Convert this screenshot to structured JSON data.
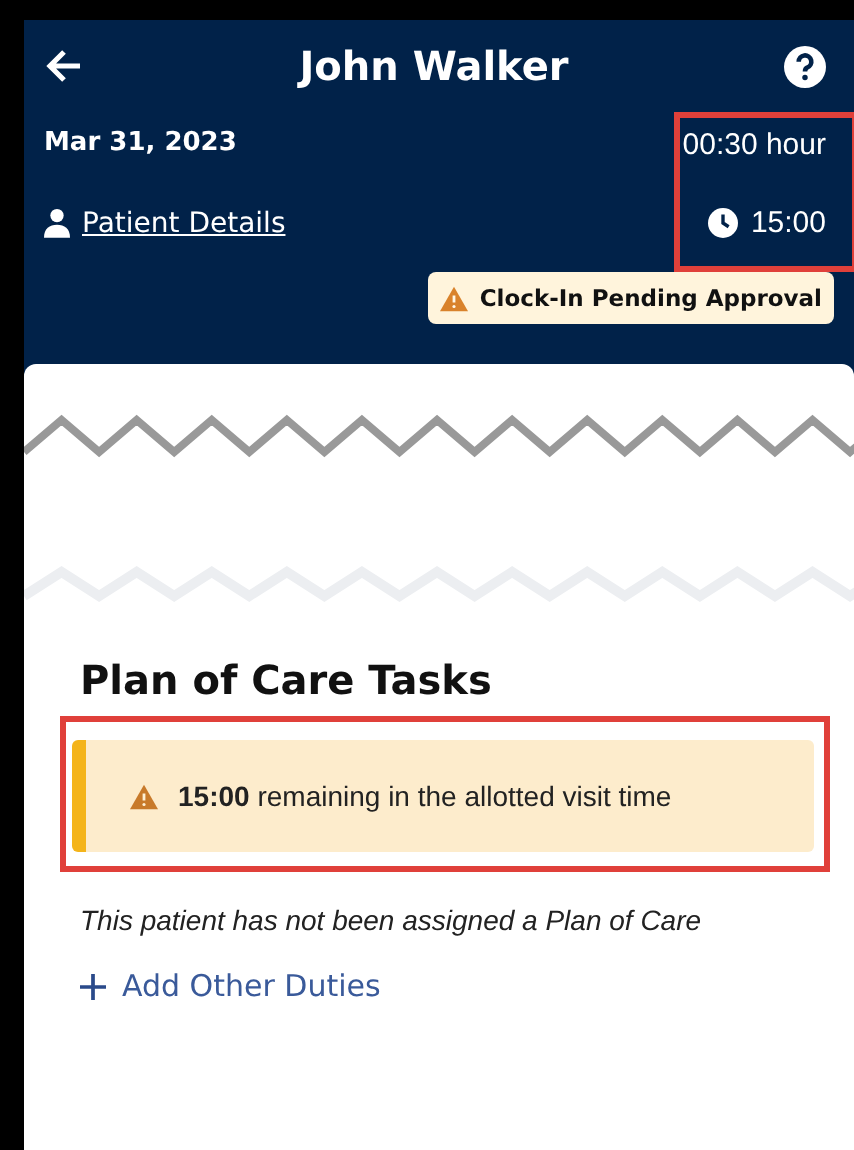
{
  "header": {
    "title": "John Walker",
    "date": "Mar 31, 2023",
    "duration": "00:30 hour",
    "patient_details_link": "Patient Details",
    "time": "15:00",
    "status_badge": "Clock-In Pending Approval"
  },
  "plan_of_care": {
    "title": "Plan of Care Tasks",
    "alert": "**15:00** remaining in the allotted visit time",
    "note": "This patient has not been assigned a Plan of Care",
    "add_button": "Add Other Duties"
  }
}
